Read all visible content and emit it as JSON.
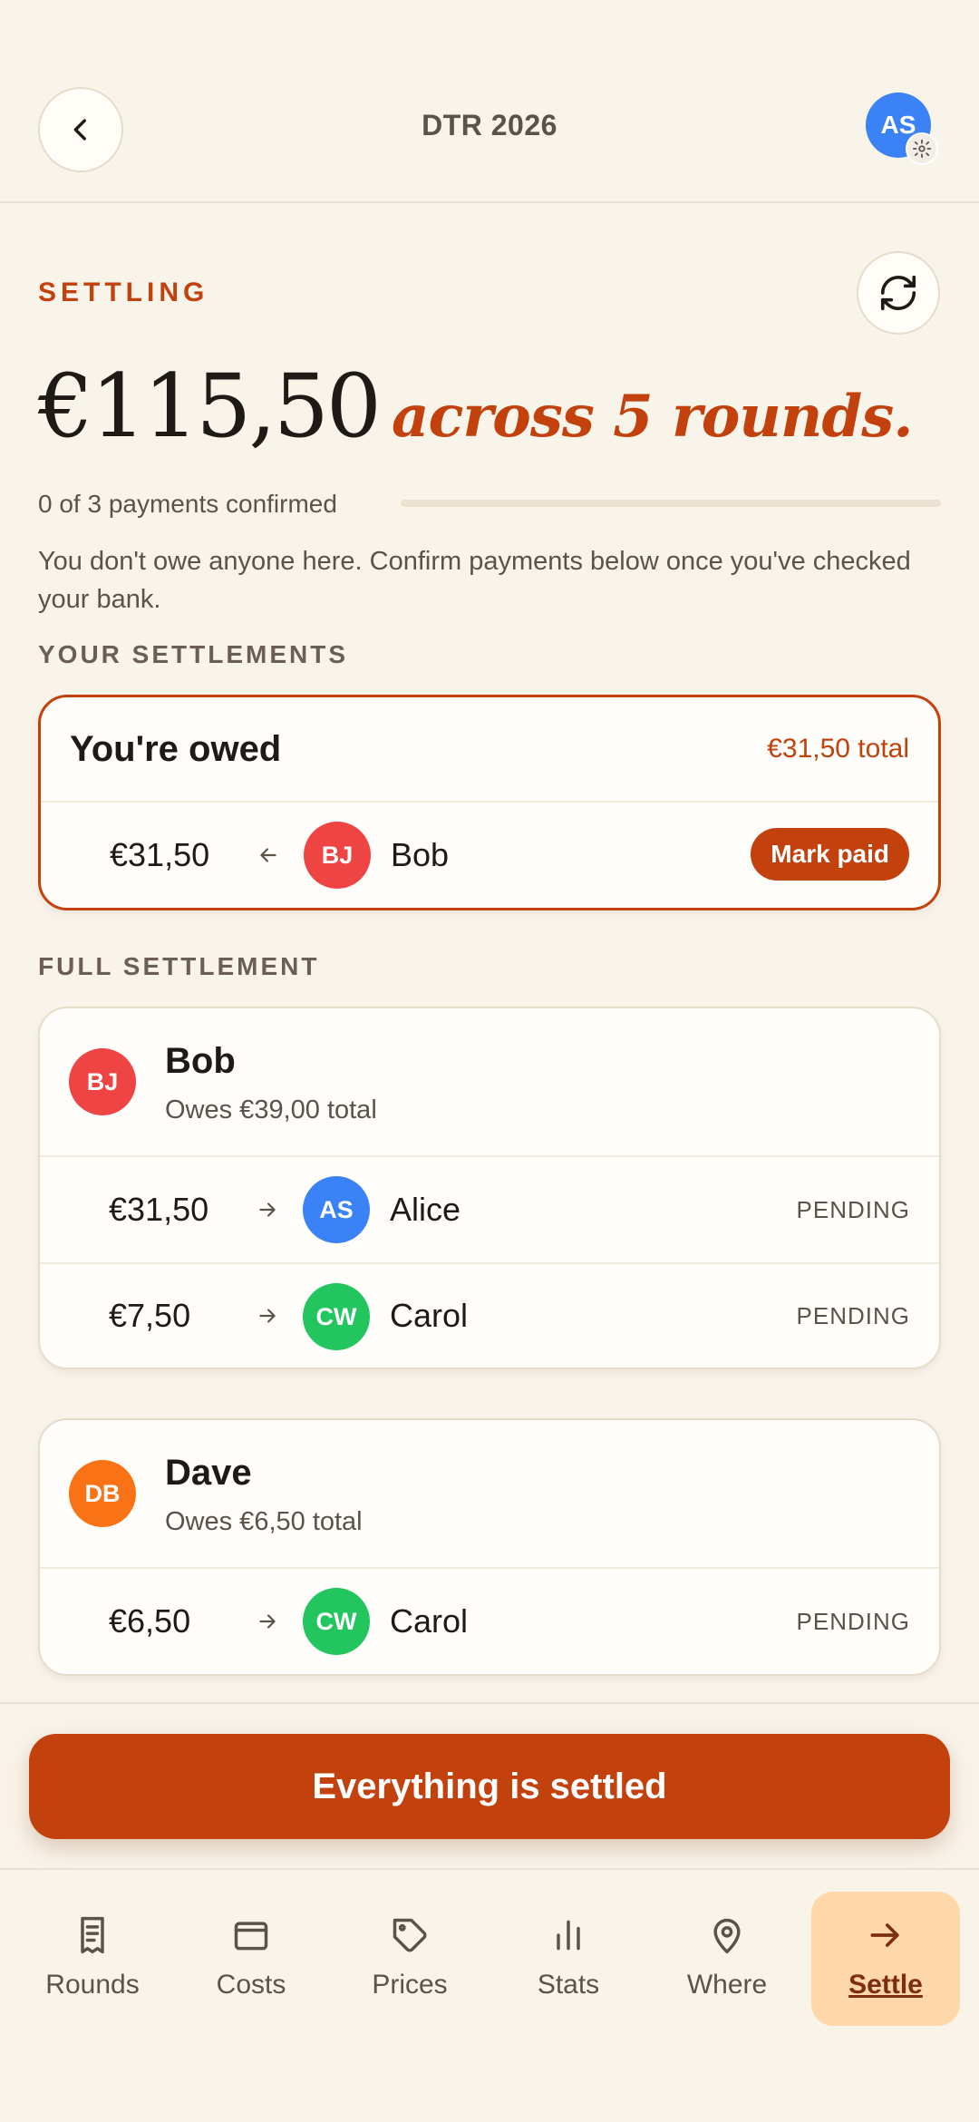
{
  "header": {
    "title": "DTR 2026",
    "user_initials": "AS",
    "user_color": "#3b82f6"
  },
  "summary": {
    "eyebrow": "SETTLING",
    "amount": "€115,50",
    "suffix": "across 5 rounds.",
    "progress_label": "0 of 3 payments confirmed",
    "confirmed": 0,
    "total_payments": 3,
    "note": "You don't owe anyone here. Confirm payments below once you've checked your bank."
  },
  "your_settlements": {
    "label": "YOUR SETTLEMENTS",
    "title": "You're owed",
    "total": "€31,50 total",
    "rows": [
      {
        "amount": "€31,50",
        "initials": "BJ",
        "name": "Bob",
        "color": "#ef4444",
        "action": "Mark paid"
      }
    ]
  },
  "full_settlement": {
    "label": "FULL SETTLEMENT",
    "debtors": [
      {
        "initials": "BJ",
        "name": "Bob",
        "color": "#ef4444",
        "owes": "Owes €39,00 total",
        "payments": [
          {
            "amount": "€31,50",
            "initials": "AS",
            "name": "Alice",
            "color": "#3b82f6",
            "status": "PENDING"
          },
          {
            "amount": "€7,50",
            "initials": "CW",
            "name": "Carol",
            "color": "#22c55e",
            "status": "PENDING"
          }
        ]
      },
      {
        "initials": "DB",
        "name": "Dave",
        "color": "#f97316",
        "owes": "Owes €6,50 total",
        "payments": [
          {
            "amount": "€6,50",
            "initials": "CW",
            "name": "Carol",
            "color": "#22c55e",
            "status": "PENDING"
          }
        ]
      }
    ]
  },
  "cta": {
    "label": "Everything is settled"
  },
  "nav": {
    "items": [
      {
        "label": "Rounds",
        "icon": "receipt-icon"
      },
      {
        "label": "Costs",
        "icon": "wallet-icon"
      },
      {
        "label": "Prices",
        "icon": "tag-icon"
      },
      {
        "label": "Stats",
        "icon": "bar-chart-icon"
      },
      {
        "label": "Where",
        "icon": "map-pin-icon"
      },
      {
        "label": "Settle",
        "icon": "arrow-right-icon"
      }
    ],
    "active": "Settle"
  }
}
